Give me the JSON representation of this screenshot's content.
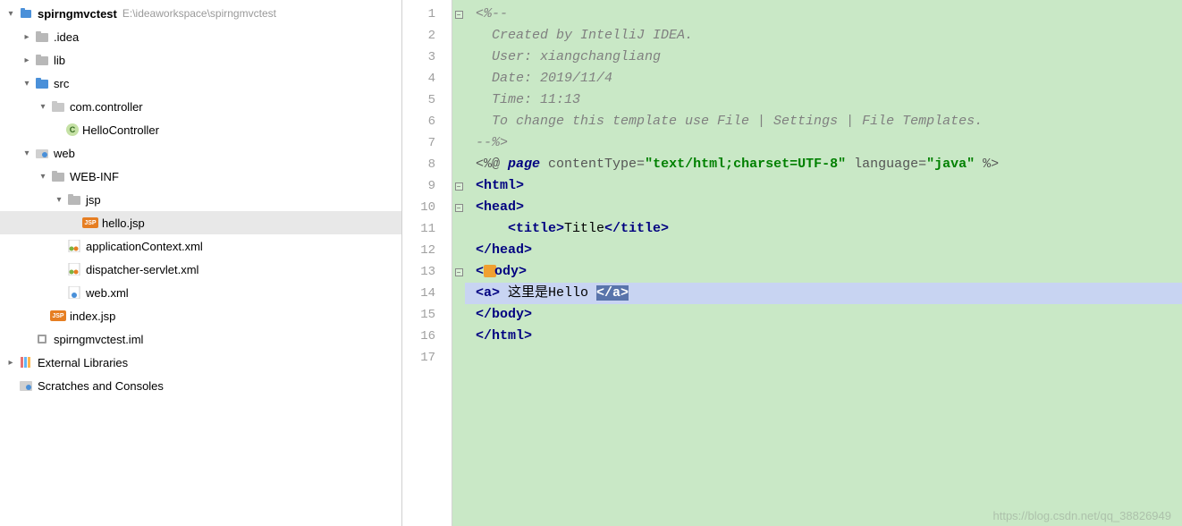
{
  "tree": {
    "root": {
      "label": "spirngmvctest",
      "hint": "E:\\ideaworkspace\\spirngmvctest"
    },
    "idea": ".idea",
    "lib": "lib",
    "src": "src",
    "pkg": "com.controller",
    "class1": "HelloController",
    "web": "web",
    "webinf": "WEB-INF",
    "jsp": "jsp",
    "hellojsp": "hello.jsp",
    "appctx": "applicationContext.xml",
    "dispatcher": "dispatcher-servlet.xml",
    "webxml": "web.xml",
    "indexjsp": "index.jsp",
    "iml": "spirngmvctest.iml",
    "extlib": "External Libraries",
    "scratch": "Scratches and Consoles"
  },
  "gutter": [
    "1",
    "2",
    "3",
    "4",
    "5",
    "6",
    "7",
    "8",
    "9",
    "10",
    "11",
    "12",
    "13",
    "14",
    "15",
    "16",
    "17"
  ],
  "code": {
    "l1": "<%--",
    "l2": "  Created by IntelliJ IDEA.",
    "l3": "  User: xiangchangliang",
    "l4": "  Date: 2019/11/4",
    "l5": "  Time: 11:13",
    "l6": "  To change this template use File | Settings | File Templates.",
    "l7": "--%>",
    "l8_open": "<%@ ",
    "l8_page": "page",
    "l8_attr1": " contentType=",
    "l8_val1": "\"text/html;charset=UTF-8\"",
    "l8_attr2": " language=",
    "l8_val2": "\"java\"",
    "l8_close": " %>",
    "l9": "<html>",
    "l10": "<head>",
    "l11_open": "    <title>",
    "l11_text": "Title",
    "l11_close": "</title>",
    "l12": "</head>",
    "l13_open": "<",
    "l13_rest": "ody>",
    "l14_a1": "<a>",
    "l14_text": " 这里是Hello ",
    "l14_a2": "</a>",
    "l15": "</body>",
    "l16": "</html>",
    "l17": ""
  },
  "watermark": "https://blog.csdn.net/qq_38826949"
}
